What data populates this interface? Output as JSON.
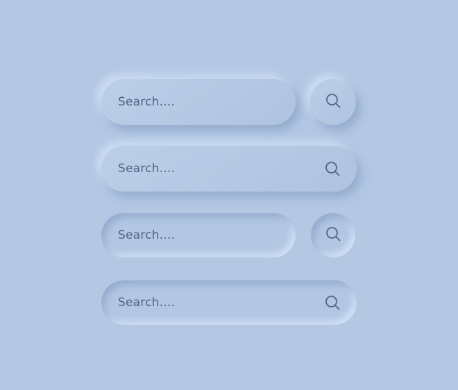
{
  "colors": {
    "background": "#b4c8e4",
    "text": "#516684",
    "icon": "#516684"
  },
  "search_bars": [
    {
      "style": "raised-with-separate-button",
      "placeholder": "Search....",
      "icon": "search-icon"
    },
    {
      "style": "raised-with-inline-icon",
      "placeholder": "Search....",
      "icon": "search-icon"
    },
    {
      "style": "inset-with-separate-button",
      "placeholder": "Search....",
      "icon": "search-icon"
    },
    {
      "style": "inset-with-inline-icon",
      "placeholder": "Search....",
      "icon": "search-icon"
    }
  ]
}
